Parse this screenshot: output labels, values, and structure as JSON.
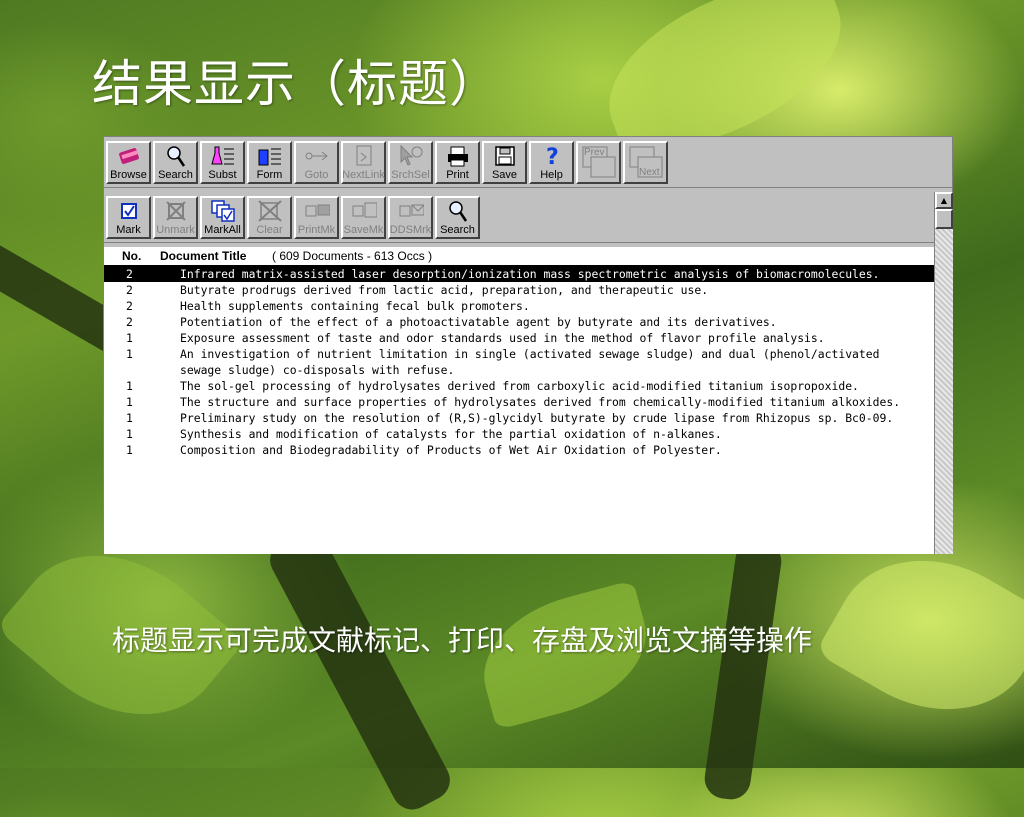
{
  "slide": {
    "title": "结果显示（标题）",
    "caption": "标题显示可完成文献标记、打印、存盘及浏览文摘等操作"
  },
  "toolbar1": [
    {
      "label": "Browse",
      "icon": "book-icon",
      "enabled": true
    },
    {
      "label": "Search",
      "icon": "magnifier-icon",
      "enabled": true
    },
    {
      "label": "Subst",
      "icon": "flask-icon",
      "enabled": true
    },
    {
      "label": "Form",
      "icon": "beaker-icon",
      "enabled": true
    },
    {
      "label": "Goto",
      "icon": "goto-icon",
      "enabled": false
    },
    {
      "label": "NextLink",
      "icon": "nextlink-icon",
      "enabled": false
    },
    {
      "label": "SrchSel",
      "icon": "pointer-search-icon",
      "enabled": false
    },
    {
      "label": "Print",
      "icon": "printer-icon",
      "enabled": true
    },
    {
      "label": "Save",
      "icon": "floppy-icon",
      "enabled": true
    },
    {
      "label": "Help",
      "icon": "question-icon",
      "enabled": true
    },
    {
      "label": "Prev",
      "icon": "prev-page-icon",
      "enabled": false
    },
    {
      "label": "Next",
      "icon": "next-page-icon",
      "enabled": false
    }
  ],
  "toolbar2": [
    {
      "label": "Mark",
      "icon": "checkbox-icon",
      "enabled": true
    },
    {
      "label": "Unmark",
      "icon": "unmark-icon",
      "enabled": false
    },
    {
      "label": "MarkAll",
      "icon": "markall-icon",
      "enabled": true
    },
    {
      "label": "Clear",
      "icon": "clear-icon",
      "enabled": false
    },
    {
      "label": "PrintMk",
      "icon": "print-marked-icon",
      "enabled": false
    },
    {
      "label": "SaveMk",
      "icon": "save-marked-icon",
      "enabled": false
    },
    {
      "label": "DDSMrk",
      "icon": "dds-mark-icon",
      "enabled": false
    },
    {
      "label": "Search",
      "icon": "magnifier-icon",
      "enabled": true
    }
  ],
  "list": {
    "col_no": "No.",
    "col_title": "Document Title",
    "summary": "( 609 Documents - 613 Occs )",
    "rows": [
      {
        "no": "2",
        "title": "Infrared matrix-assisted laser desorption/ionization mass spectrometric analysis of biomacromolecules.",
        "selected": true
      },
      {
        "no": "2",
        "title": "Butyrate prodrugs derived from lactic acid, preparation, and therapeutic use."
      },
      {
        "no": "2",
        "title": "Health supplements containing fecal bulk promoters."
      },
      {
        "no": "2",
        "title": "Potentiation of the effect of a photoactivatable agent by butyrate and its derivatives."
      },
      {
        "no": "1",
        "title": "Exposure assessment of taste and odor standards used in the method of flavor profile analysis."
      },
      {
        "no": "1",
        "title": "An investigation of nutrient limitation in single (activated sewage sludge) and dual (phenol/activated sewage sludge) co-disposals with refuse."
      },
      {
        "no": "1",
        "title": "The sol-gel processing of hydrolysates derived from carboxylic acid-modified titanium isopropoxide."
      },
      {
        "no": "1",
        "title": "The structure and surface properties of hydrolysates derived from chemically-modified titanium alkoxides."
      },
      {
        "no": "1",
        "title": "Preliminary study on the resolution of (R,S)-glycidyl butyrate by crude lipase from Rhizopus sp. Bc0-09."
      },
      {
        "no": "1",
        "title": "Synthesis and modification of catalysts for the partial oxidation of n-alkanes."
      },
      {
        "no": "1",
        "title": "Composition and Biodegradability of Products of Wet Air Oxidation of Polyester."
      }
    ]
  },
  "scrollbar": {
    "up_glyph": "▲"
  },
  "colors": {
    "selection_bg": "#000000",
    "toolbar_bg": "#c0c0c0",
    "title_text": "#ffffff"
  }
}
